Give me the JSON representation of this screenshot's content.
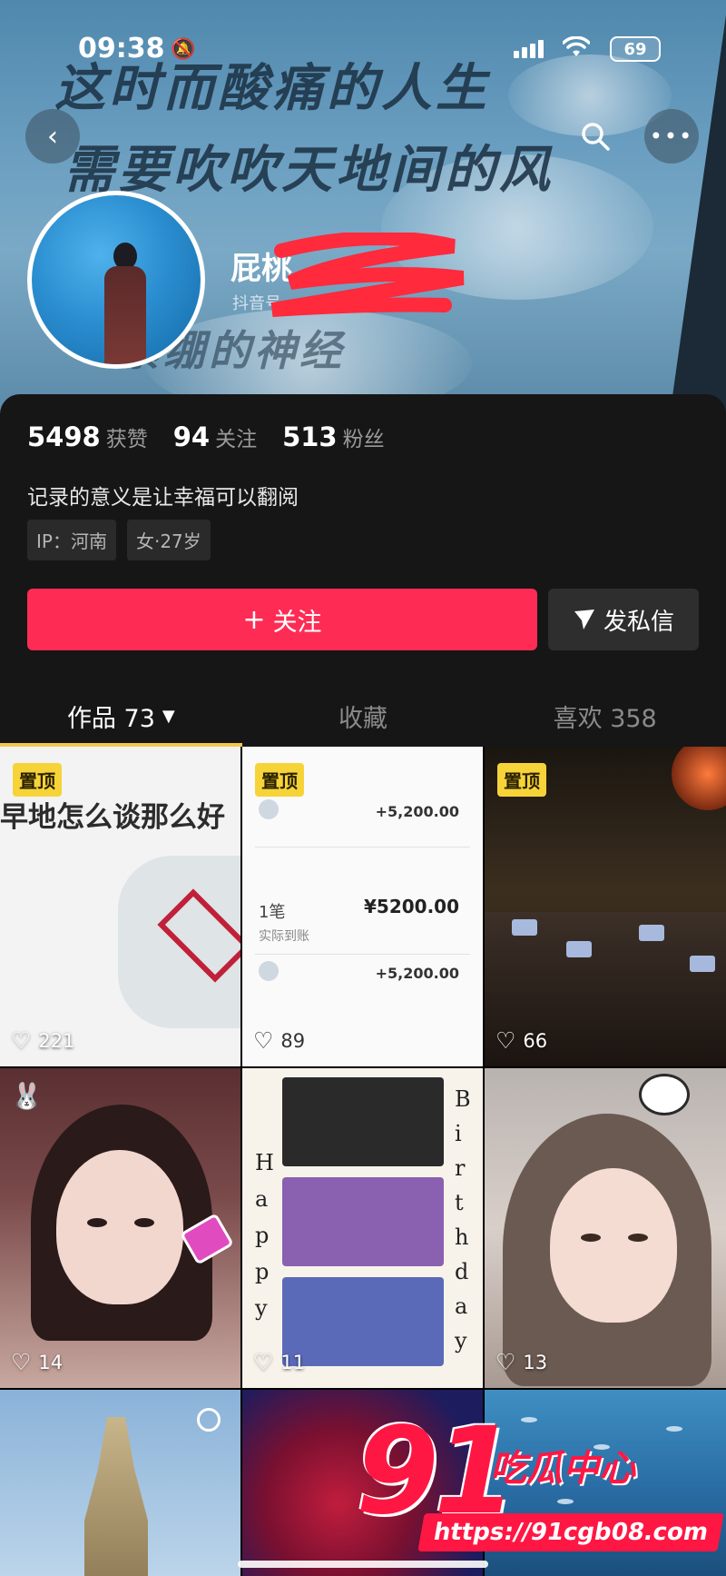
{
  "status_bar": {
    "time": "09:38",
    "battery": "69"
  },
  "banner": {
    "handwriting_line1": "这时而酸痛的人生",
    "handwriting_line2": "需要吹吹天地间的风",
    "handwriting_line3": "紧绷的神经"
  },
  "profile": {
    "username": "屁桃",
    "account_id": "抖音号",
    "stats": [
      {
        "value": "5498",
        "label": "获赞"
      },
      {
        "value": "94",
        "label": "关注"
      },
      {
        "value": "513",
        "label": "粉丝"
      }
    ],
    "bio": "记录的意义是让幸福可以翻阅",
    "tags": [
      "IP：河南",
      "女·27岁"
    ],
    "follow_label": "关注",
    "message_label": "发私信"
  },
  "tabs": [
    {
      "label": "作品 73"
    },
    {
      "label": "收藏"
    },
    {
      "label": "喜欢 358"
    }
  ],
  "videos": [
    {
      "pinned": "置顶",
      "likes": "221",
      "caption": "早地怎么谈那么好"
    },
    {
      "pinned": "置顶",
      "likes": "89",
      "amounts": [
        "+5,200.00",
        "¥5200.00",
        "+5,200.00"
      ],
      "labels": [
        "1笔",
        "实际到账"
      ]
    },
    {
      "pinned": "置顶",
      "likes": "66"
    },
    {
      "likes": "14"
    },
    {
      "likes": "11",
      "birthday_left": [
        "H",
        "a",
        "p",
        "p",
        "y"
      ],
      "birthday_right": [
        "B",
        "i",
        "r",
        "t",
        "h",
        "d",
        "a",
        "y"
      ]
    },
    {
      "likes": "13"
    },
    {},
    {},
    {}
  ],
  "watermark": {
    "number": "91",
    "brand": "吃瓜中心",
    "url": "https://91cgb08.com"
  },
  "colors": {
    "accent": "#fe2c55",
    "tab_indicator": "#f2c94c",
    "pin_badge": "#f6d439"
  }
}
